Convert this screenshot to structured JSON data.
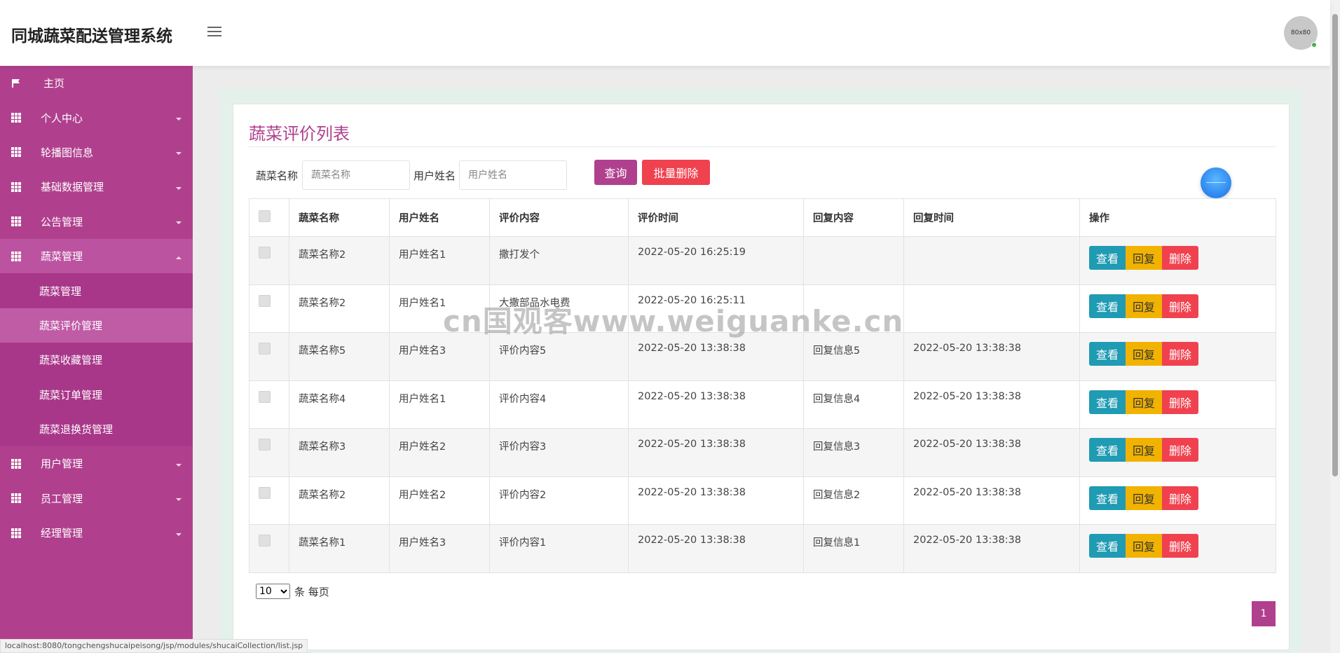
{
  "header": {
    "app_title": "同城蔬菜配送管理系统",
    "avatar_text": "80x80"
  },
  "sidebar": {
    "home": "主页",
    "items": [
      {
        "label": "个人中心"
      },
      {
        "label": "轮播图信息"
      },
      {
        "label": "基础数据管理"
      },
      {
        "label": "公告管理"
      },
      {
        "label": "蔬菜管理",
        "open": true
      },
      {
        "label": "蔬菜管理"
      },
      {
        "label": "蔬菜评价管理",
        "active": true
      },
      {
        "label": "蔬菜收藏管理"
      },
      {
        "label": "蔬菜订单管理"
      },
      {
        "label": "蔬菜退换货管理"
      },
      {
        "label": "用户管理"
      },
      {
        "label": "员工管理"
      },
      {
        "label": "经理管理"
      }
    ]
  },
  "main": {
    "title": "蔬菜评价列表",
    "search": {
      "veg_label": "蔬菜名称",
      "veg_placeholder": "蔬菜名称",
      "user_label": "用户姓名",
      "user_placeholder": "用户姓名",
      "query_btn": "查询",
      "batch_delete_btn": "批量删除"
    },
    "table": {
      "columns": [
        "蔬菜名称",
        "用户姓名",
        "评价内容",
        "评价时间",
        "回复内容",
        "回复时间",
        "操作"
      ],
      "rows": [
        [
          "蔬菜名称2",
          "用户姓名1",
          "撒打发个",
          "2022-05-20 16:25:19",
          "",
          ""
        ],
        [
          "蔬菜名称2",
          "用户姓名1",
          "大撒部品水电费",
          "2022-05-20 16:25:11",
          "",
          ""
        ],
        [
          "蔬菜名称5",
          "用户姓名3",
          "评价内容5",
          "2022-05-20 13:38:38",
          "回复信息5",
          "2022-05-20 13:38:38"
        ],
        [
          "蔬菜名称4",
          "用户姓名1",
          "评价内容4",
          "2022-05-20 13:38:38",
          "回复信息4",
          "2022-05-20 13:38:38"
        ],
        [
          "蔬菜名称3",
          "用户姓名2",
          "评价内容3",
          "2022-05-20 13:38:38",
          "回复信息3",
          "2022-05-20 13:38:38"
        ],
        [
          "蔬菜名称2",
          "用户姓名2",
          "评价内容2",
          "2022-05-20 13:38:38",
          "回复信息2",
          "2022-05-20 13:38:38"
        ],
        [
          "蔬菜名称1",
          "用户姓名3",
          "评价内容1",
          "2022-05-20 13:38:38",
          "回复信息1",
          "2022-05-20 13:38:38"
        ]
      ],
      "ops": {
        "view": "查看",
        "reply": "回复",
        "delete": "删除"
      }
    },
    "pager": {
      "page_size": "10",
      "suffix": "条 每页",
      "current_page": "1"
    }
  },
  "watermark": "cn国观客www.weiguanke.cn",
  "status_url": "localhost:8080/tongchengshucaipeisong/jsp/modules/shucaiCollection/list.jsp",
  "colors": {
    "primary": "#b0408e",
    "danger": "#f0414f",
    "info": "#1f9bb3",
    "warning": "#f1b300"
  }
}
